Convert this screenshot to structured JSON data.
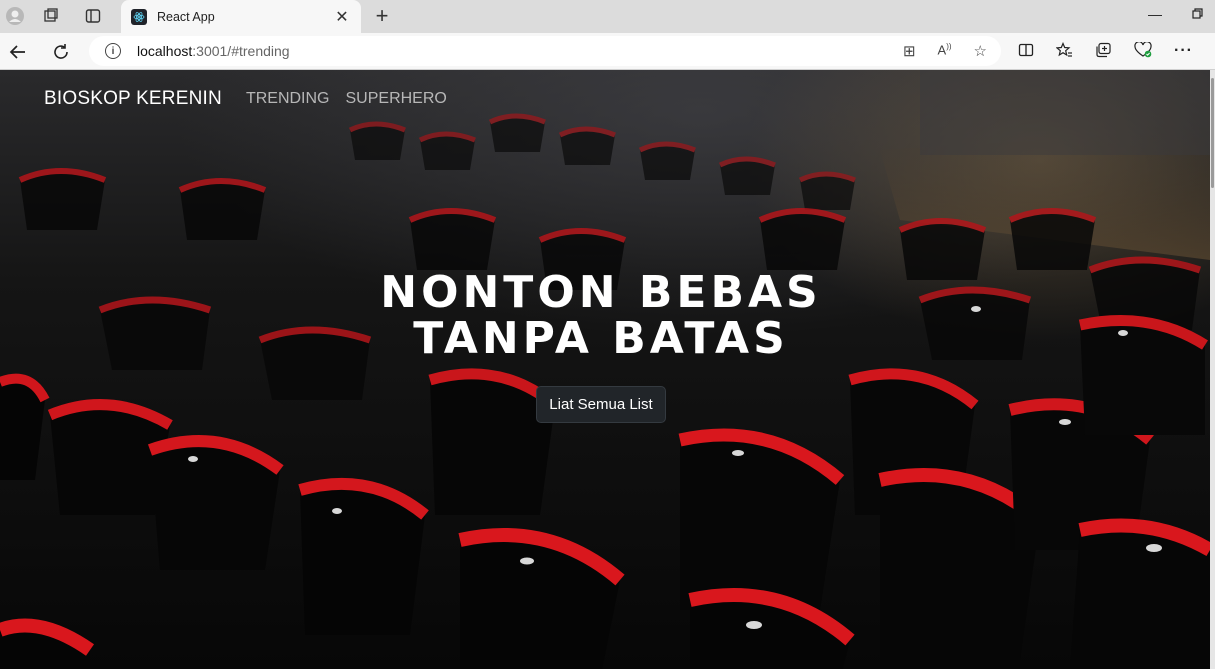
{
  "browser": {
    "tab_title": "React App",
    "url_host": "localhost",
    "url_rest": ":3001/#trending"
  },
  "navbar": {
    "brand": "BIOSKOP KERENIN",
    "links": [
      "TRENDING",
      "SUPERHERO"
    ]
  },
  "hero": {
    "title_line1": "NONTON BEBAS",
    "title_line2": "TANPA BATAS",
    "cta_label": "Liat Semua List"
  },
  "colors": {
    "seat_red": "#c8151b",
    "button_bg": "#212529"
  },
  "icons": {
    "profile": "profile-icon",
    "workspaces": "workspaces-icon",
    "tab_actions": "tab-actions-icon",
    "back": "back-icon",
    "refresh": "refresh-icon",
    "info": "info-icon"
  }
}
